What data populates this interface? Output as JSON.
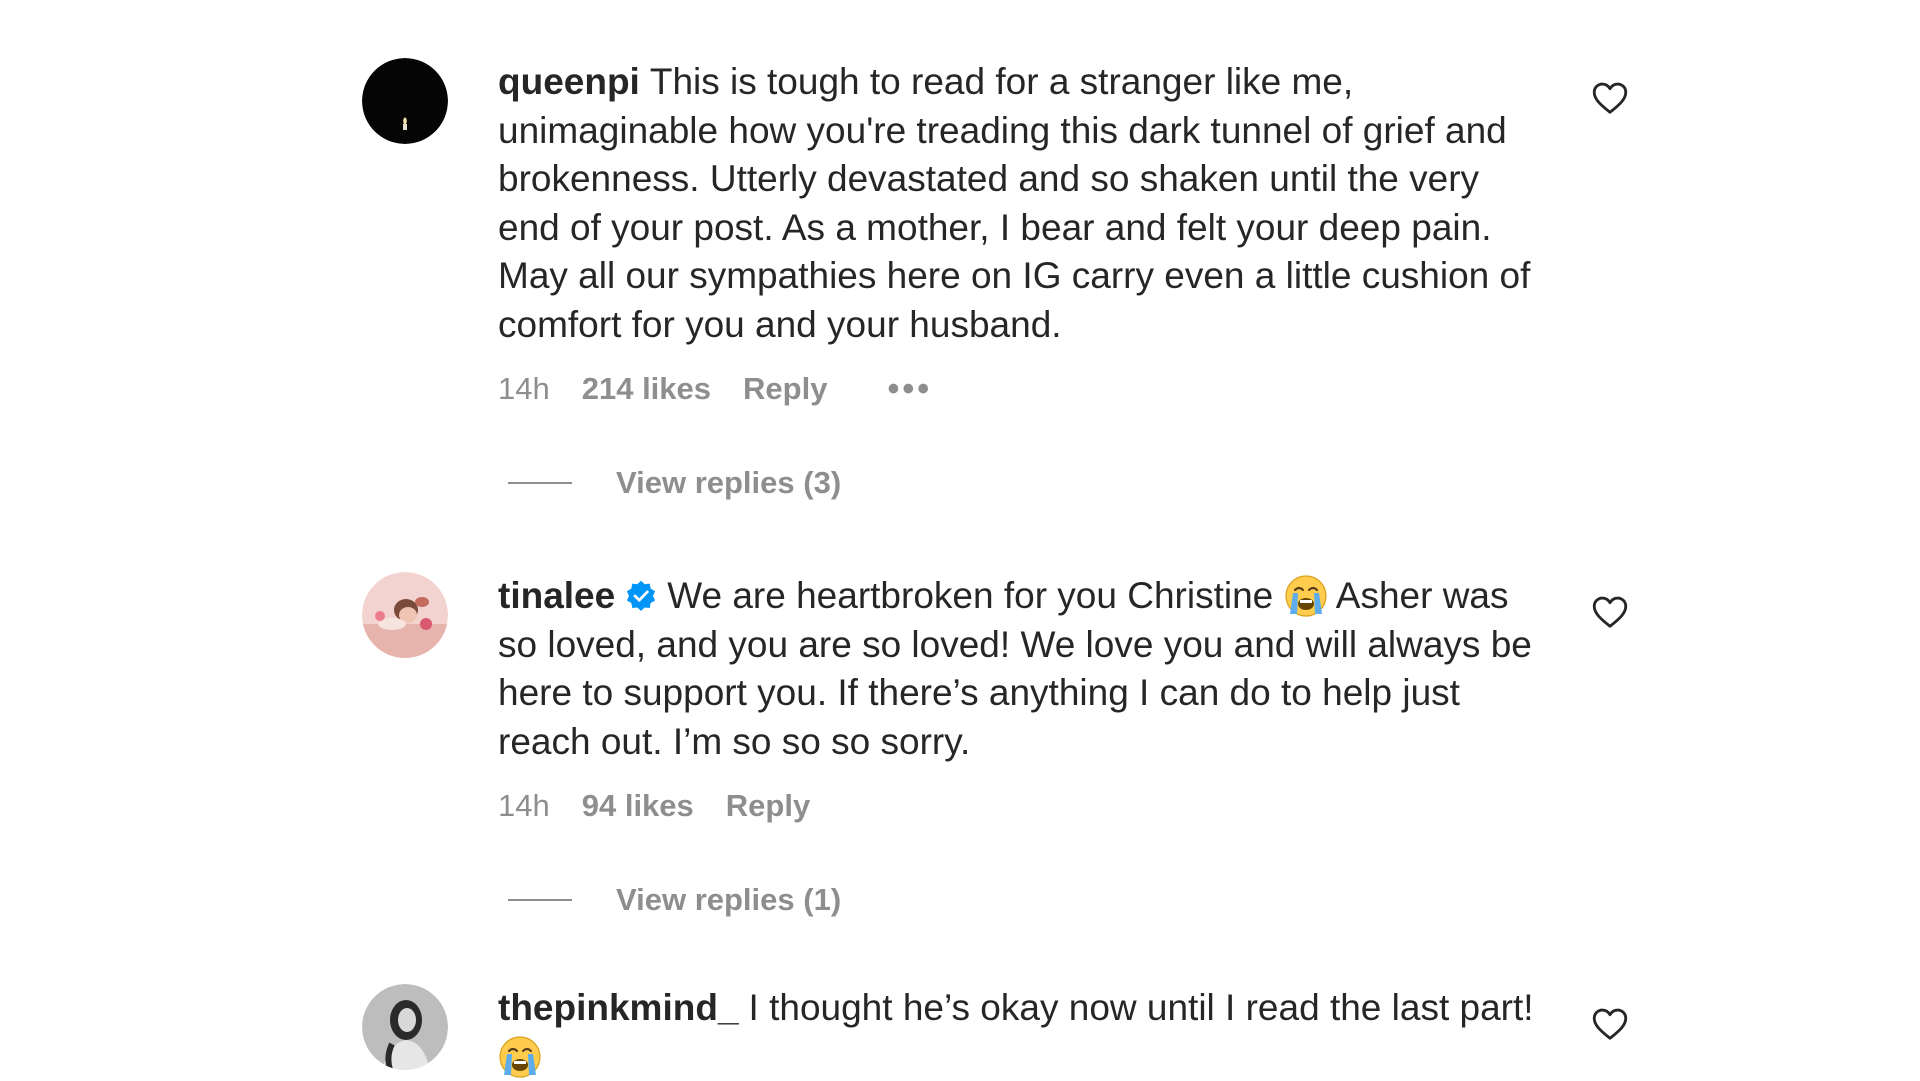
{
  "comments": [
    {
      "username": "queenpi",
      "verified": false,
      "text": "This is tough to read for a stranger like me, unimaginable how you're treading this dark tunnel of grief and brokenness. Utterly devastated and so shaken until the very end of your post. As a mother, I bear and felt your deep pain. May all our sympathies here on IG carry even a little cushion of comfort for you and your husband.",
      "time": "14h",
      "likes": "214 likes",
      "reply_label": "Reply",
      "more_label": "•••",
      "view_replies": "View replies (3)"
    },
    {
      "username": "tinalee",
      "verified": true,
      "text_before_emoji": "We are heartbroken for you Christine",
      "emoji": "crying-face-emoji",
      "text_after_emoji": "Asher was so loved, and you are so loved! We love you and will always be here to support you. If there’s anything I can do to help just reach out. I’m so so so sorry.",
      "time": "14h",
      "likes": "94 likes",
      "reply_label": "Reply",
      "view_replies": "View replies (1)"
    },
    {
      "username": "thepinkmind_",
      "verified": false,
      "text": "I thought he’s okay now until I read the last part!",
      "emoji": "crying-face-emoji"
    }
  ],
  "icons": {
    "like": "heart-outline-icon",
    "verified": "verified-badge-icon",
    "more": "more-options-icon"
  },
  "colors": {
    "text": "#262626",
    "secondary": "#8e8e8e",
    "verified": "#0095f6",
    "background": "#ffffff"
  }
}
